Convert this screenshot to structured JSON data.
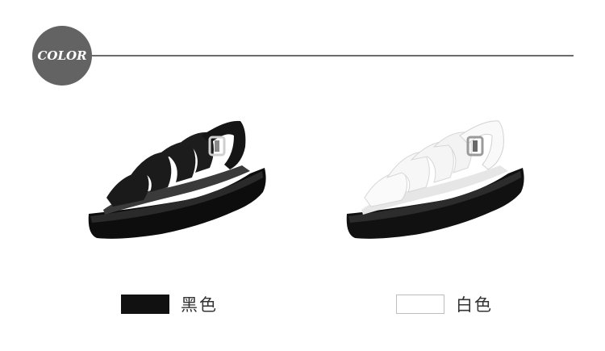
{
  "header": {
    "badge_label": "COLOR",
    "badge_color": "#636363",
    "rule_color": "#6b6b6b"
  },
  "colors": [
    {
      "name": "黑色",
      "swatch_color": "#111111",
      "image_icon": "black-sandal-image"
    },
    {
      "name": "白色",
      "swatch_color": "#ffffff",
      "image_icon": "white-sandal-image"
    }
  ]
}
